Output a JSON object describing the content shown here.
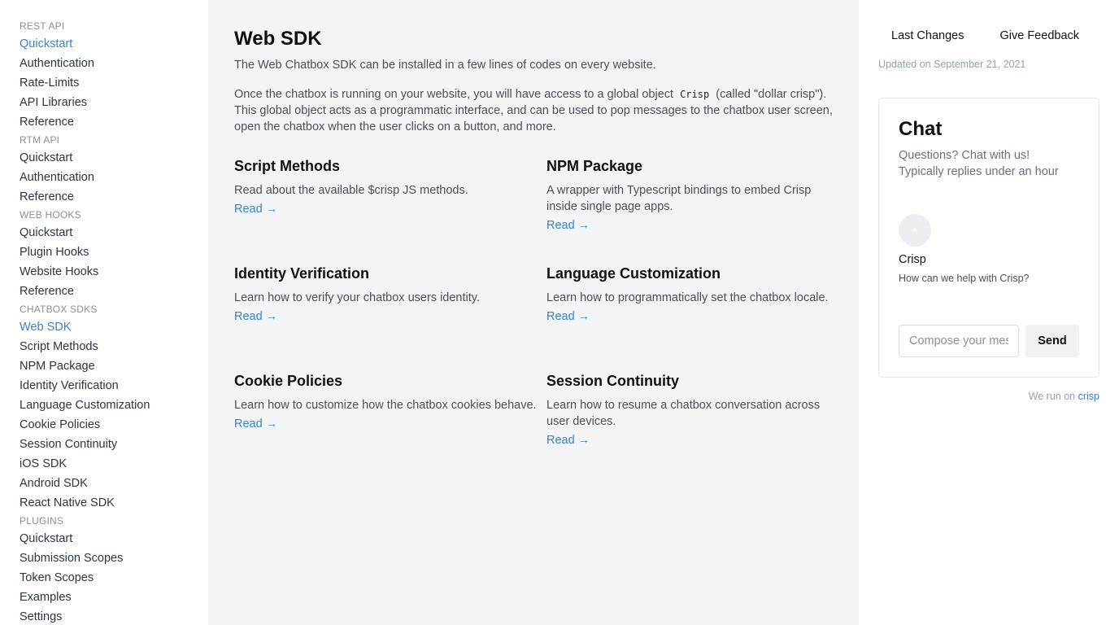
{
  "sidebar": {
    "sections": [
      {
        "heading": "REST API",
        "items": [
          "Quickstart",
          "Authentication",
          "Rate-Limits",
          "API Libraries",
          "Reference"
        ]
      },
      {
        "heading": "RTM API",
        "items": [
          "Quickstart",
          "Authentication",
          "Reference"
        ]
      },
      {
        "heading": "WEB HOOKS",
        "items": [
          "Quickstart",
          "Plugin Hooks",
          "Website Hooks",
          "Reference"
        ]
      },
      {
        "heading": "CHATBOX SDKS",
        "items": [
          "Web SDK",
          "Script Methods",
          "NPM Package",
          "Identity Verification",
          "Language Customization",
          "Cookie Policies",
          "Session Continuity",
          "iOS SDK",
          "Android SDK",
          "React Native SDK"
        ]
      },
      {
        "heading": "PLUGINS",
        "items": [
          "Quickstart",
          "Submission Scopes",
          "Token Scopes",
          "Examples",
          "Settings"
        ]
      }
    ]
  },
  "main": {
    "title": "Web SDK",
    "intro": "The Web Chatbox SDK can be installed in a few lines of codes on every website.",
    "para_before": "Once the chatbox is running on your website, you will have access to a global object",
    "para_code": "Crisp",
    "para_after": "(called \"dollar crisp\"). This global object acts as a programmatic interface, and can be used to pop messages to the chatbox user screen, open the chatbox when the user clicks on a button, and more.",
    "read_label": "Read →",
    "cards": [
      {
        "title": "Script Methods",
        "desc": "Read about the available $crisp JS methods."
      },
      {
        "title": "NPM Package",
        "desc": "A wrapper with Typescript bindings to embed Crisp inside single page apps."
      },
      {
        "title": "Identity Verification",
        "desc": "Learn how to verify your chatbox users identity."
      },
      {
        "title": "Language Customization",
        "desc": "Learn how to programmatically set the chatbox locale."
      },
      {
        "title": "Cookie Policies",
        "desc": "Learn how to customize how the chatbox cookies behave."
      },
      {
        "title": "Session Continuity",
        "desc": "Learn how to resume a chatbox conversation across user devices."
      }
    ]
  },
  "right": {
    "last_changes": "Last Changes",
    "give_feedback": "Give Feedback",
    "updated": "Updated on September 21, 2021",
    "chat": {
      "title": "Chat",
      "sub1": "Questions? Chat with us!",
      "sub2": "Typically replies under an hour",
      "agent_name": "Crisp",
      "agent_msg": "How can we help with Crisp?",
      "compose_placeholder": "Compose your message...",
      "send_label": "Send"
    },
    "powered_prefix": "We run on",
    "powered_link": "crisp"
  },
  "colors": {
    "accent": "#3b82c4",
    "main_bg": "#f3f4f6"
  }
}
